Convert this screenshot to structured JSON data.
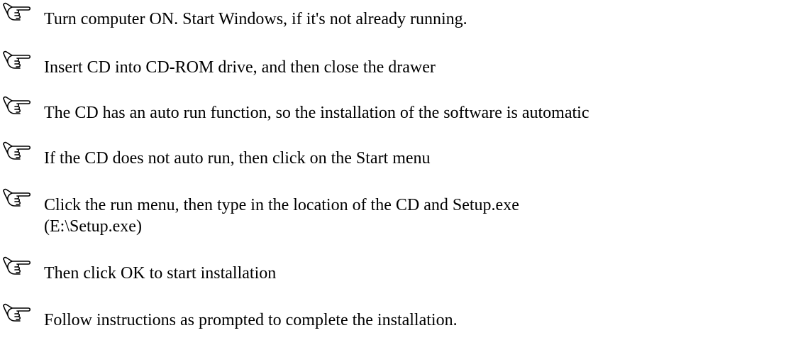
{
  "icon_name": "pointing-hand-icon",
  "steps": [
    {
      "lines": [
        "Turn computer ON.  Start Windows, if it's not already running."
      ]
    },
    {
      "lines": [
        "Insert CD into CD-ROM drive, and then close the drawer"
      ]
    },
    {
      "lines": [
        "The CD has an auto run function, so the installation of the software is automatic"
      ]
    },
    {
      "lines": [
        "If the CD does not auto run, then click on the Start menu"
      ]
    },
    {
      "lines": [
        "Click the run menu, then type in the location of the CD and Setup.exe",
        "(E:\\Setup.exe)"
      ]
    },
    {
      "lines": [
        "Then click OK to start installation"
      ]
    },
    {
      "lines": [
        "Follow instructions as prompted to complete the installation."
      ]
    }
  ]
}
